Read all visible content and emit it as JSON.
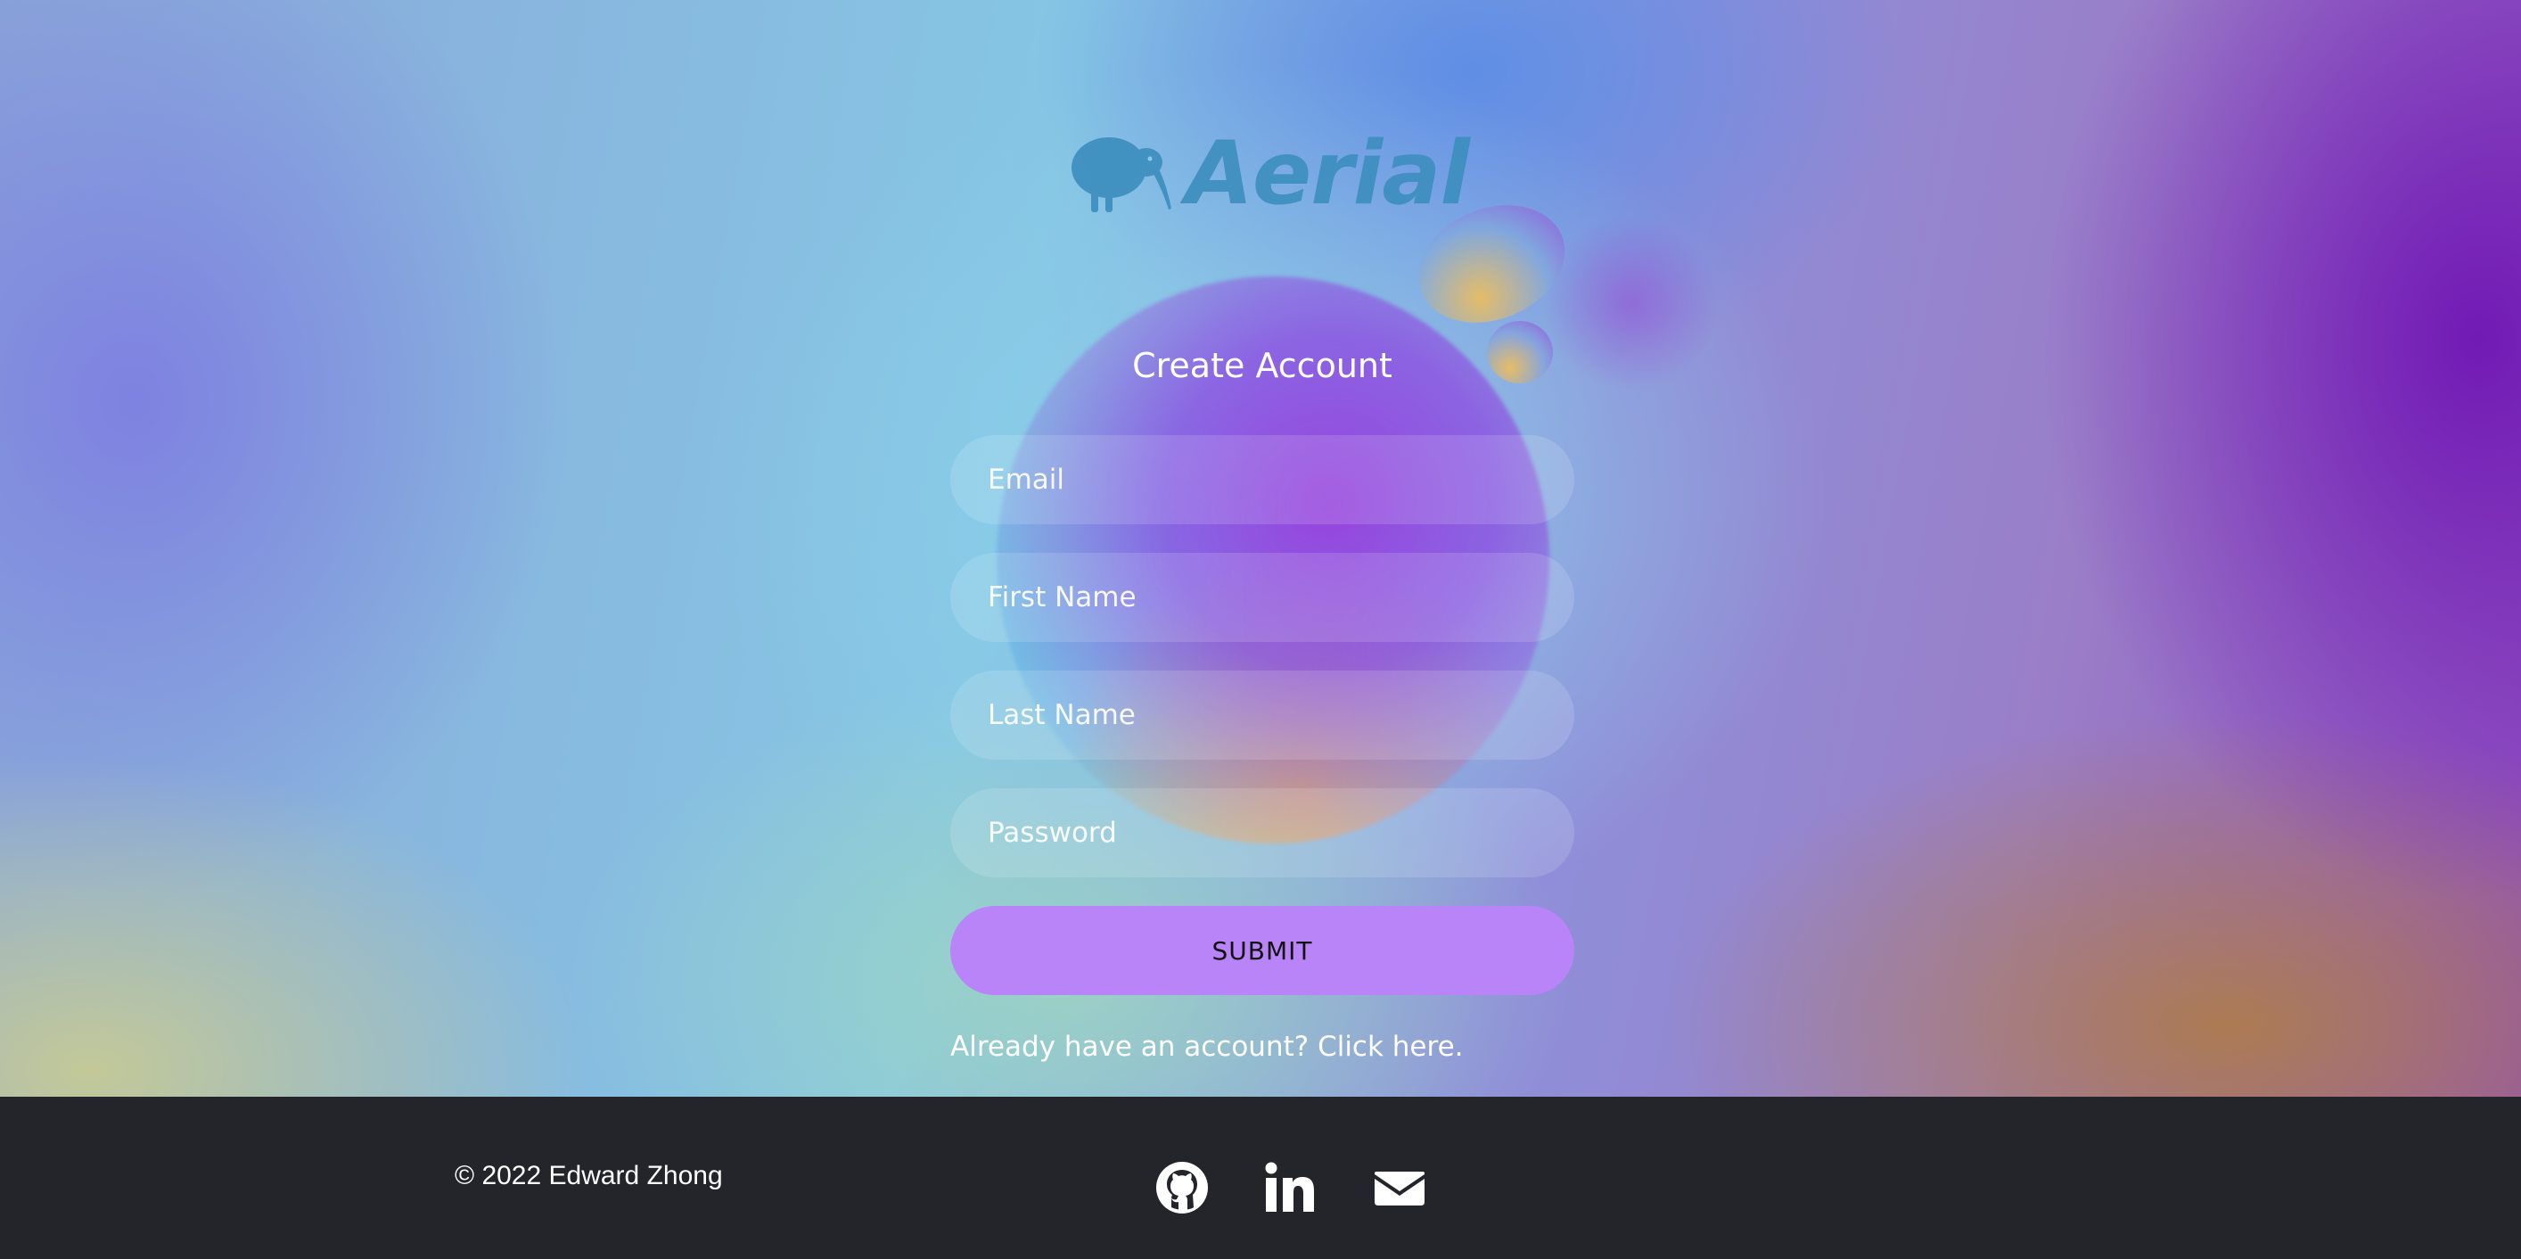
{
  "brand": {
    "name": "Aerial",
    "logo_icon": "kiwi-bird-icon",
    "logo_color": "#3d8fbf"
  },
  "form": {
    "title": "Create Account",
    "email_placeholder": "Email",
    "first_name_placeholder": "First Name",
    "last_name_placeholder": "Last Name",
    "password_placeholder": "Password",
    "submit_label": "SUBMIT",
    "submit_color": "#b884f7",
    "login_prompt": "Already have an account?",
    "login_link": "Click here."
  },
  "footer": {
    "copyright": "© 2022 Edward Zhong",
    "background": "#23252a",
    "socials": [
      {
        "icon": "github-icon"
      },
      {
        "icon": "linkedin-icon"
      },
      {
        "icon": "mail-icon"
      }
    ]
  }
}
